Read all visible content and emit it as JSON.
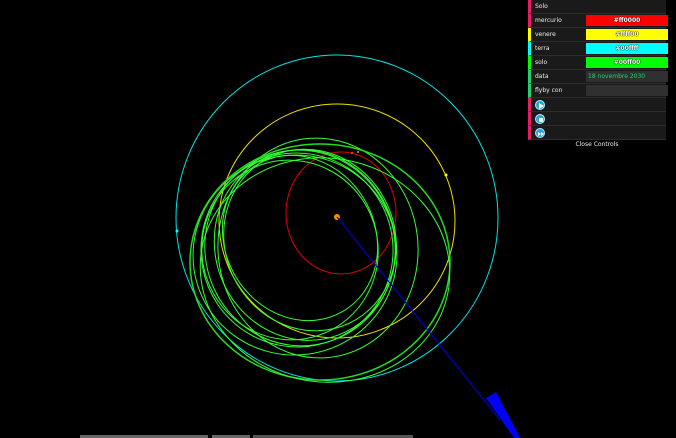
{
  "controls": {
    "header": "Solo",
    "rows": [
      {
        "label": "mercurio",
        "value": "#ff0000",
        "color": "#ff0000"
      },
      {
        "label": "venere",
        "value": "#ffff00",
        "color": "#ffff00"
      },
      {
        "label": "terra",
        "value": "#00ffff",
        "color": "#00ffff"
      },
      {
        "label": "solo",
        "value": "#00ff00",
        "color": "#00ff00"
      }
    ],
    "data_label": "data",
    "data_value": "18 novembre 2030",
    "flyby_label": "flyby con",
    "flyby_value": "",
    "play_icon": "play-icon",
    "stop_icon": "stop-icon",
    "forward_icon": "fast-forward-icon",
    "close_label": "Close Controls"
  },
  "scene_colors": {
    "sun": "#ff8c00",
    "mercury_orbit": "#ff0000",
    "venus_orbit": "#ffff00",
    "earth_orbit": "#00ffff",
    "solar_orbiter": "#00ff00",
    "direction_arrow": "#0000ff"
  }
}
